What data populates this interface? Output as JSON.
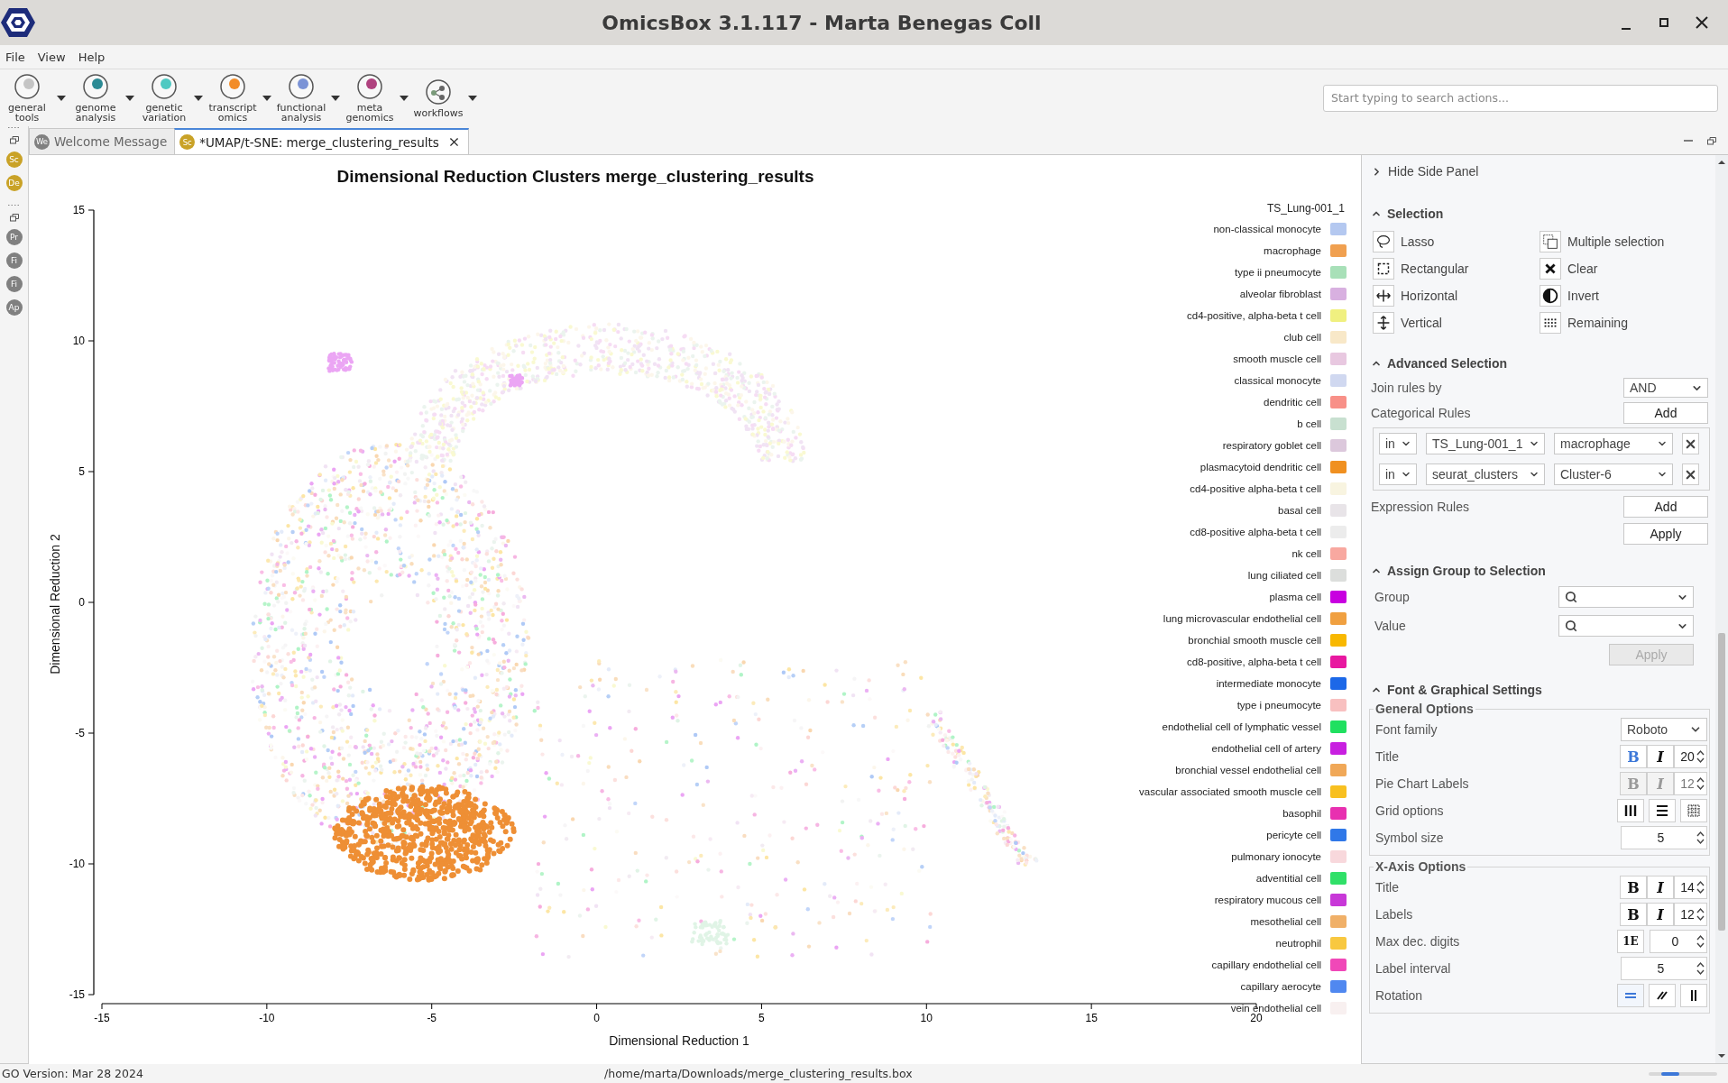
{
  "window": {
    "title": "OmicsBox 3.1.117 - Marta Benegas Coll"
  },
  "menu": [
    "File",
    "View",
    "Help"
  ],
  "toolbar": {
    "tools": [
      {
        "kind": "circle",
        "lines": [
          "general",
          "tools"
        ],
        "color": "#c4c4c4"
      },
      {
        "kind": "circle",
        "lines": [
          "genome",
          "analysis"
        ],
        "color": "#2b8a94"
      },
      {
        "kind": "circle",
        "lines": [
          "genetic",
          "variation"
        ],
        "color": "#4fc9c2"
      },
      {
        "kind": "circle",
        "lines": [
          "transcript",
          "omics"
        ],
        "color": "#f28c28"
      },
      {
        "kind": "circle",
        "lines": [
          "functional",
          "analysis"
        ],
        "color": "#7b93d6"
      },
      {
        "kind": "circle",
        "lines": [
          "meta",
          "genomics"
        ],
        "color": "#b0427f"
      },
      {
        "kind": "network",
        "lines": [
          "workflows"
        ]
      }
    ],
    "search": {
      "placeholder": "Start typing to search actions..."
    }
  },
  "dock": [
    {
      "items": [
        {
          "label": "Sc",
          "color": "#c9a227"
        },
        {
          "label": "De",
          "color": "#c9a227"
        }
      ]
    },
    {
      "items": [
        {
          "label": "Pr",
          "color": "#808080"
        },
        {
          "label": "Fi",
          "color": "#808080"
        },
        {
          "label": "Fi",
          "color": "#808080"
        },
        {
          "label": "Ap",
          "color": "#808080"
        }
      ]
    }
  ],
  "tabs": [
    {
      "icon_text": "We",
      "color": "#808080",
      "label": "Welcome Message",
      "selected": false
    },
    {
      "icon_text": "Sc",
      "color": "#c9a227",
      "label": "*UMAP/t-SNE: merge_clustering_results",
      "selected": true
    }
  ],
  "plot": {
    "title": "Dimensional Reduction Clusters merge_clustering_results",
    "xlabel": "Dimensional Reduction 1",
    "ylabel": "Dimensional Reduction 2",
    "xticks": [
      "-15",
      "-10",
      "-5",
      "0",
      "5",
      "10",
      "15",
      "20"
    ],
    "yticks": [
      "15",
      "10",
      "5",
      "0",
      "-5",
      "-10",
      "-15"
    ],
    "legend": {
      "title": "TS_Lung-001_1",
      "items": [
        {
          "label": "non-classical monocyte",
          "color": "#b4c8f0"
        },
        {
          "label": "macrophage",
          "color": "#f0a050"
        },
        {
          "label": "type ii pneumocyte",
          "color": "#a8e0b8"
        },
        {
          "label": "alveolar fibroblast",
          "color": "#d8b0e0"
        },
        {
          "label": "cd4-positive, alpha-beta t cell",
          "color": "#f0f080"
        },
        {
          "label": "club cell",
          "color": "#f8e8c8"
        },
        {
          "label": "smooth muscle cell",
          "color": "#e8c8e0"
        },
        {
          "label": "classical monocyte",
          "color": "#d0d8f0"
        },
        {
          "label": "dendritic cell",
          "color": "#f89088"
        },
        {
          "label": "b cell",
          "color": "#c8e0d0"
        },
        {
          "label": "respiratory goblet cell",
          "color": "#dcc8dc"
        },
        {
          "label": "plasmacytoid dendritic cell",
          "color": "#f09020"
        },
        {
          "label": "cd4-positive alpha-beta t cell",
          "color": "#f8f4e0"
        },
        {
          "label": "basal cell",
          "color": "#e8e4e8"
        },
        {
          "label": "cd8-positive alpha-beta t cell",
          "color": "#ececec"
        },
        {
          "label": "nk cell",
          "color": "#f8a8a0"
        },
        {
          "label": "lung ciliated cell",
          "color": "#dcdedc"
        },
        {
          "label": "plasma cell",
          "color": "#c800e0"
        },
        {
          "label": "lung microvascular endothelial cell",
          "color": "#f0a040"
        },
        {
          "label": "bronchial smooth muscle cell",
          "color": "#f8b800"
        },
        {
          "label": "cd8-positive, alpha-beta t cell",
          "color": "#e818a0"
        },
        {
          "label": "intermediate monocyte",
          "color": "#1c68e8"
        },
        {
          "label": "type i pneumocyte",
          "color": "#f8c0c0"
        },
        {
          "label": "endothelial cell of lymphatic vessel",
          "color": "#20e060"
        },
        {
          "label": "endothelial cell of artery",
          "color": "#c820e0"
        },
        {
          "label": "bronchial vessel endothelial cell",
          "color": "#f0a858"
        },
        {
          "label": "vascular associated smooth muscle cell",
          "color": "#f8c020"
        },
        {
          "label": "basophil",
          "color": "#e830b0"
        },
        {
          "label": "pericyte cell",
          "color": "#3078e8"
        },
        {
          "label": "pulmonary ionocyte",
          "color": "#f8d8dc"
        },
        {
          "label": "adventitial cell",
          "color": "#30e068"
        },
        {
          "label": "respiratory mucous cell",
          "color": "#c838d8"
        },
        {
          "label": "mesothelial cell",
          "color": "#f0b068"
        },
        {
          "label": "neutrophil",
          "color": "#f8c840"
        },
        {
          "label": "capillary endothelial cell",
          "color": "#f048b8"
        },
        {
          "label": "capillary aerocyte",
          "color": "#5088f0"
        },
        {
          "label": "vein endothelial cell",
          "color": "#f8f0f0"
        }
      ]
    }
  },
  "side_panel": {
    "hide_label": "Hide Side Panel",
    "selection": {
      "title": "Selection",
      "tools": [
        {
          "kind": "lasso",
          "label": "Lasso"
        },
        {
          "kind": "multiple",
          "label": "Multiple selection"
        },
        {
          "kind": "rectangular",
          "label": "Rectangular"
        },
        {
          "kind": "clear",
          "label": "Clear"
        },
        {
          "kind": "horizontal",
          "label": "Horizontal"
        },
        {
          "kind": "invert",
          "label": "Invert"
        },
        {
          "kind": "vertical",
          "label": "Vertical"
        },
        {
          "kind": "remaining",
          "label": "Remaining"
        }
      ]
    },
    "advanced": {
      "title": "Advanced Selection",
      "join_label": "Join rules by",
      "join_value": "AND",
      "categorical_label": "Categorical Rules",
      "categorical_add": "Add",
      "rules": [
        {
          "op": "in",
          "field": "TS_Lung-001_1",
          "value": "macrophage"
        },
        {
          "op": "in",
          "field": "seurat_clusters",
          "value": "Cluster-6"
        }
      ],
      "expression_label": "Expression Rules",
      "expression_add": "Add",
      "apply": "Apply"
    },
    "assign": {
      "title": "Assign Group to Selection",
      "fields": [
        {
          "label": "Group"
        },
        {
          "label": "Value"
        }
      ],
      "apply": {
        "label": "Apply",
        "disabled": true
      }
    },
    "graphics": {
      "title": "Font & Graphical Settings",
      "groups": [
        {
          "title": "General Options",
          "rows": [
            {
              "kind": "select",
              "label": "Font family",
              "value": "Roboto"
            },
            {
              "kind": "style",
              "label": "Title",
              "bold_label": "B",
              "italic_label": "I",
              "bold_on": true,
              "size": "20",
              "disabled": false
            },
            {
              "kind": "style",
              "label": "Pie Chart Labels",
              "bold_label": "B",
              "italic_label": "I",
              "bold_on": false,
              "size": "12",
              "disabled": true
            },
            {
              "kind": "grid",
              "label": "Grid options"
            },
            {
              "kind": "number",
              "label": "Symbol size",
              "value": "5"
            }
          ]
        },
        {
          "title": "X-Axis Options",
          "rows": [
            {
              "kind": "style",
              "label": "Title",
              "bold_label": "B",
              "italic_label": "I",
              "bold_on": false,
              "size": "14",
              "disabled": false
            },
            {
              "kind": "style",
              "label": "Labels",
              "bold_label": "B",
              "italic_label": "I",
              "bold_on": false,
              "size": "12",
              "disabled": false
            },
            {
              "kind": "digits",
              "label": "Max dec. digits",
              "badge": "1E",
              "value": "0"
            },
            {
              "kind": "number",
              "label": "Label interval",
              "value": "5"
            },
            {
              "kind": "rotation",
              "label": "Rotation",
              "options": [
                {
                  "selected": true
                },
                {
                  "selected": false
                },
                {
                  "selected": false
                }
              ]
            }
          ]
        }
      ]
    }
  },
  "status_bar": {
    "left": "GO Version: Mar 28 2024",
    "path": "/home/marta/Downloads/merge_clustering_results.box"
  }
}
